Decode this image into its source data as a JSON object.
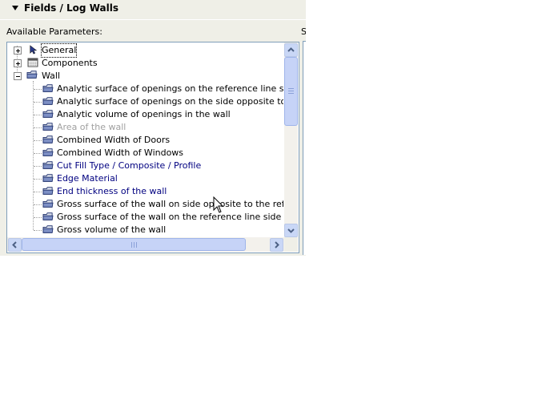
{
  "header": {
    "title": "Fields  /  Log Walls"
  },
  "available_label": "Available Parameters:",
  "side_label": "S",
  "tree": {
    "groups": [
      {
        "label": "General",
        "icon": "pointer-arrow-icon",
        "expanded": false
      },
      {
        "label": "Components",
        "icon": "components-icon",
        "expanded": false
      },
      {
        "label": "Wall",
        "icon": "folder-icon",
        "expanded": true
      }
    ],
    "wall_items": [
      {
        "label": "Analytic surface of openings on the reference line side",
        "style": "normal"
      },
      {
        "label": "Analytic surface of openings on the side opposite to the reference",
        "style": "normal"
      },
      {
        "label": "Analytic volume of openings in the wall",
        "style": "normal"
      },
      {
        "label": "Area of the wall",
        "style": "grey"
      },
      {
        "label": "Combined Width of Doors",
        "style": "normal"
      },
      {
        "label": "Combined Width of Windows",
        "style": "normal"
      },
      {
        "label": "Cut Fill Type / Composite / Profile",
        "style": "blue"
      },
      {
        "label": "Edge Material",
        "style": "blue"
      },
      {
        "label": "End thickness of the wall",
        "style": "blue"
      },
      {
        "label": "Gross surface of the wall on side opposite to the reference line",
        "style": "normal"
      },
      {
        "label": "Gross surface of the wall on the reference line side",
        "style": "normal"
      },
      {
        "label": "Gross volume of the wall",
        "style": "normal"
      }
    ]
  },
  "colors": {
    "panel_bg": "#efefe7",
    "grey_text": "#a0a0a0",
    "blue_text": "#000080",
    "scroll_accent": "#c9d7f6"
  }
}
